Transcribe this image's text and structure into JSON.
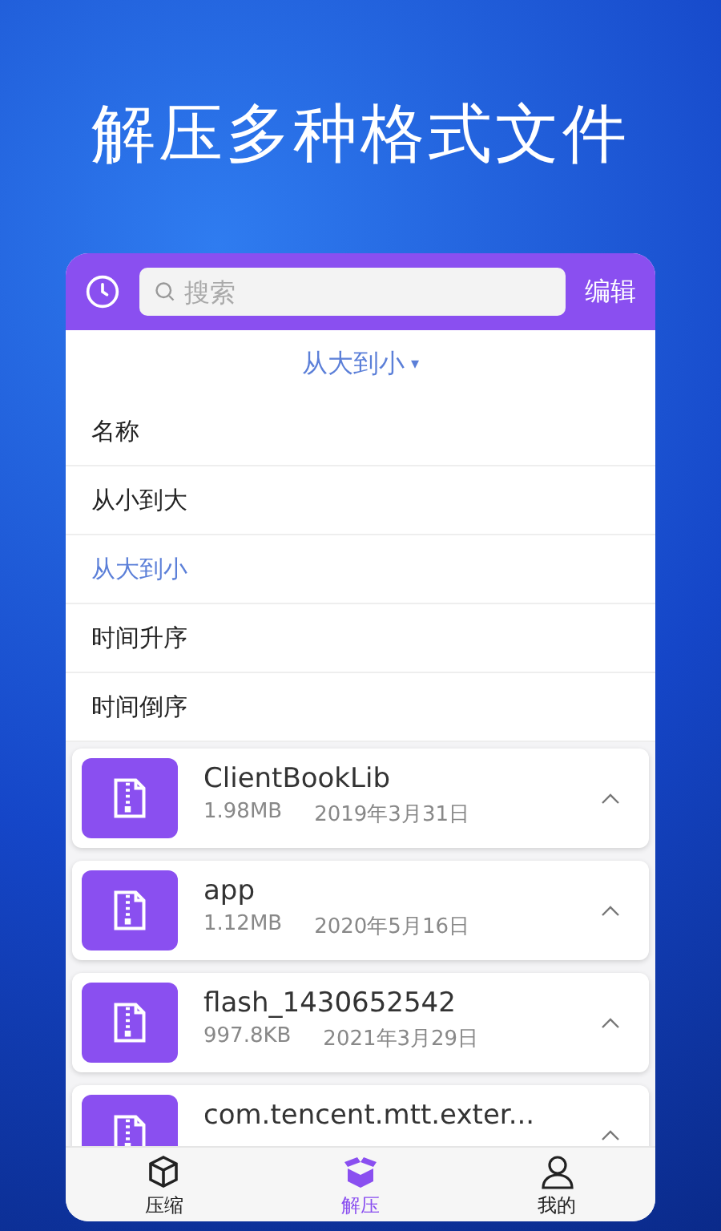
{
  "headline": "解压多种格式文件",
  "header": {
    "search": {
      "placeholder": "搜索"
    },
    "edit": "编辑"
  },
  "sort": {
    "current": "从大到小",
    "caret": "▾"
  },
  "sort_menu": [
    {
      "label": "名称",
      "selected": false
    },
    {
      "label": "从小到大",
      "selected": false
    },
    {
      "label": "从大到小",
      "selected": true
    },
    {
      "label": "时间升序",
      "selected": false
    },
    {
      "label": "时间倒序",
      "selected": false
    }
  ],
  "files": [
    {
      "name": "ClientBookLib",
      "size": "1.98MB",
      "date": "2019年3月31日"
    },
    {
      "name": "app",
      "size": "1.12MB",
      "date": "2020年5月16日"
    },
    {
      "name": "flash_1430652542",
      "size": "997.8KB",
      "date": "2021年3月29日"
    },
    {
      "name": "com.tencent.mtt.exter..."
    }
  ],
  "tabs": [
    {
      "label": "压缩",
      "kind": "box",
      "selected": false
    },
    {
      "label": "解压",
      "kind": "open-box",
      "selected": true
    },
    {
      "label": "我的",
      "kind": "person",
      "selected": false
    }
  ]
}
